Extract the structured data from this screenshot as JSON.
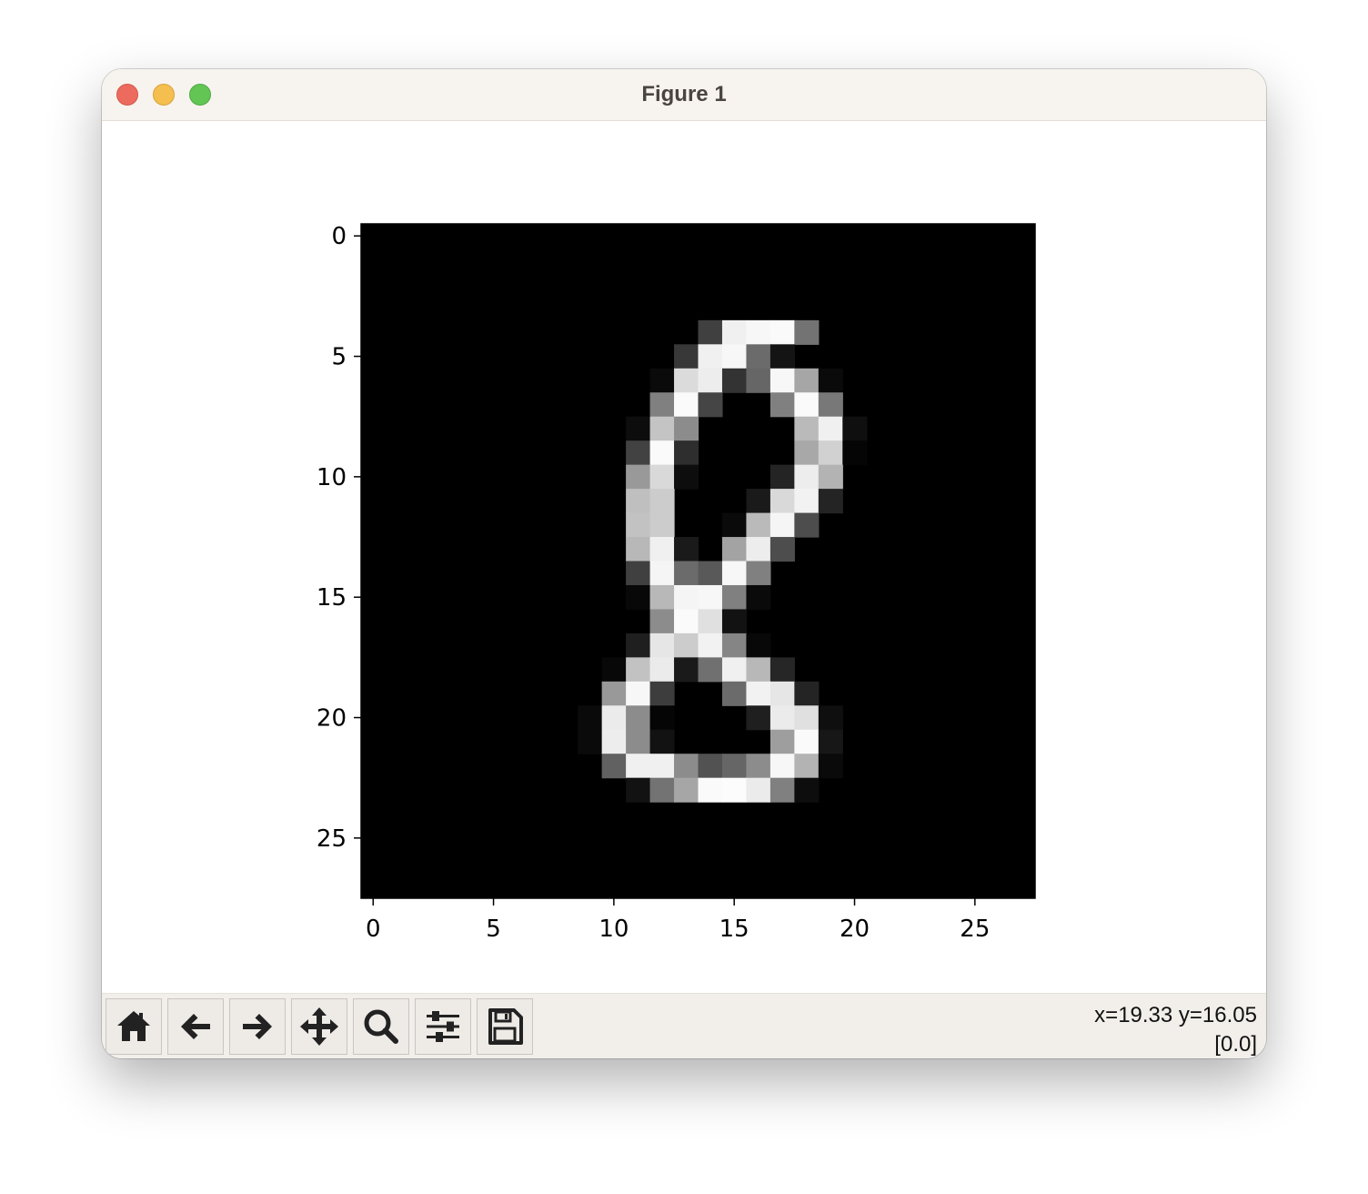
{
  "window": {
    "title": "Figure 1",
    "traffic_lights": {
      "close": "#ed6a5e",
      "minimize": "#f5bf4f",
      "zoom": "#62c554"
    }
  },
  "toolbar": {
    "buttons": [
      {
        "name": "home",
        "icon": "home-icon"
      },
      {
        "name": "back",
        "icon": "arrow-left-icon"
      },
      {
        "name": "forward",
        "icon": "arrow-right-icon"
      },
      {
        "name": "pan",
        "icon": "move-arrows-icon"
      },
      {
        "name": "zoom",
        "icon": "magnifier-icon"
      },
      {
        "name": "configure-subplots",
        "icon": "sliders-icon"
      },
      {
        "name": "save",
        "icon": "floppy-disk-icon"
      }
    ],
    "status_coords": "x=19.33 y=16.05",
    "status_value": "[0.0]"
  },
  "chart_data": {
    "type": "heatmap",
    "colormap": "gray",
    "shape": [
      28,
      28
    ],
    "xlim": [
      -0.5,
      27.5
    ],
    "ylim": [
      27.5,
      -0.5
    ],
    "xticks": [
      0,
      5,
      10,
      15,
      20,
      25
    ],
    "yticks": [
      0,
      5,
      10,
      15,
      20,
      25
    ],
    "pixels": [
      [
        4,
        14,
        0.25
      ],
      [
        4,
        15,
        0.94
      ],
      [
        4,
        16,
        0.97
      ],
      [
        4,
        17,
        0.98
      ],
      [
        4,
        18,
        0.45
      ],
      [
        5,
        13,
        0.22
      ],
      [
        5,
        14,
        0.94
      ],
      [
        5,
        15,
        0.97
      ],
      [
        5,
        16,
        0.42
      ],
      [
        5,
        17,
        0.08
      ],
      [
        6,
        12,
        0.04
      ],
      [
        6,
        13,
        0.86
      ],
      [
        6,
        14,
        0.93
      ],
      [
        6,
        15,
        0.2
      ],
      [
        6,
        16,
        0.4
      ],
      [
        6,
        17,
        0.97
      ],
      [
        6,
        18,
        0.65
      ],
      [
        6,
        19,
        0.04
      ],
      [
        7,
        12,
        0.5
      ],
      [
        7,
        13,
        0.98
      ],
      [
        7,
        14,
        0.27
      ],
      [
        7,
        17,
        0.5
      ],
      [
        7,
        18,
        0.98
      ],
      [
        7,
        19,
        0.47
      ],
      [
        8,
        11,
        0.05
      ],
      [
        8,
        12,
        0.77
      ],
      [
        8,
        13,
        0.55
      ],
      [
        8,
        18,
        0.73
      ],
      [
        8,
        19,
        0.94
      ],
      [
        8,
        20,
        0.06
      ],
      [
        9,
        11,
        0.26
      ],
      [
        9,
        12,
        0.98
      ],
      [
        9,
        13,
        0.18
      ],
      [
        9,
        18,
        0.66
      ],
      [
        9,
        19,
        0.82
      ],
      [
        9,
        20,
        0.02
      ],
      [
        10,
        11,
        0.6
      ],
      [
        10,
        12,
        0.85
      ],
      [
        10,
        13,
        0.05
      ],
      [
        10,
        17,
        0.14
      ],
      [
        10,
        18,
        0.93
      ],
      [
        10,
        19,
        0.7
      ],
      [
        11,
        11,
        0.75
      ],
      [
        11,
        12,
        0.8
      ],
      [
        11,
        16,
        0.1
      ],
      [
        11,
        17,
        0.85
      ],
      [
        11,
        18,
        0.95
      ],
      [
        11,
        19,
        0.14
      ],
      [
        12,
        11,
        0.76
      ],
      [
        12,
        12,
        0.8
      ],
      [
        12,
        15,
        0.04
      ],
      [
        12,
        16,
        0.73
      ],
      [
        12,
        17,
        0.96
      ],
      [
        12,
        18,
        0.3
      ],
      [
        13,
        11,
        0.72
      ],
      [
        13,
        12,
        0.94
      ],
      [
        13,
        13,
        0.1
      ],
      [
        13,
        15,
        0.64
      ],
      [
        13,
        16,
        0.93
      ],
      [
        13,
        17,
        0.3
      ],
      [
        14,
        11,
        0.25
      ],
      [
        14,
        12,
        0.96
      ],
      [
        14,
        13,
        0.42
      ],
      [
        14,
        14,
        0.35
      ],
      [
        14,
        15,
        0.97
      ],
      [
        14,
        16,
        0.5
      ],
      [
        15,
        11,
        0.03
      ],
      [
        15,
        12,
        0.72
      ],
      [
        15,
        13,
        0.96
      ],
      [
        15,
        14,
        0.97
      ],
      [
        15,
        15,
        0.5
      ],
      [
        15,
        16,
        0.04
      ],
      [
        16,
        12,
        0.55
      ],
      [
        16,
        13,
        0.98
      ],
      [
        16,
        14,
        0.88
      ],
      [
        16,
        15,
        0.07
      ],
      [
        17,
        11,
        0.12
      ],
      [
        17,
        12,
        0.9
      ],
      [
        17,
        13,
        0.8
      ],
      [
        17,
        14,
        0.95
      ],
      [
        17,
        15,
        0.52
      ],
      [
        17,
        16,
        0.03
      ],
      [
        18,
        10,
        0.03
      ],
      [
        18,
        11,
        0.76
      ],
      [
        18,
        12,
        0.92
      ],
      [
        18,
        13,
        0.1
      ],
      [
        18,
        14,
        0.44
      ],
      [
        18,
        15,
        0.94
      ],
      [
        18,
        16,
        0.72
      ],
      [
        18,
        17,
        0.15
      ],
      [
        19,
        10,
        0.6
      ],
      [
        19,
        11,
        0.97
      ],
      [
        19,
        12,
        0.24
      ],
      [
        19,
        15,
        0.42
      ],
      [
        19,
        16,
        0.95
      ],
      [
        19,
        17,
        0.9
      ],
      [
        19,
        18,
        0.14
      ],
      [
        20,
        9,
        0.04
      ],
      [
        20,
        10,
        0.92
      ],
      [
        20,
        11,
        0.55
      ],
      [
        20,
        12,
        0.02
      ],
      [
        20,
        16,
        0.12
      ],
      [
        20,
        17,
        0.92
      ],
      [
        20,
        18,
        0.88
      ],
      [
        20,
        19,
        0.06
      ],
      [
        21,
        9,
        0.04
      ],
      [
        21,
        10,
        0.93
      ],
      [
        21,
        11,
        0.55
      ],
      [
        21,
        12,
        0.07
      ],
      [
        21,
        17,
        0.62
      ],
      [
        21,
        18,
        0.98
      ],
      [
        21,
        19,
        0.09
      ],
      [
        22,
        10,
        0.38
      ],
      [
        22,
        11,
        0.94
      ],
      [
        22,
        12,
        0.94
      ],
      [
        22,
        13,
        0.55
      ],
      [
        22,
        14,
        0.32
      ],
      [
        22,
        15,
        0.4
      ],
      [
        22,
        16,
        0.55
      ],
      [
        22,
        17,
        0.97
      ],
      [
        22,
        18,
        0.7
      ],
      [
        22,
        19,
        0.04
      ],
      [
        23,
        11,
        0.07
      ],
      [
        23,
        12,
        0.45
      ],
      [
        23,
        13,
        0.65
      ],
      [
        23,
        14,
        0.98
      ],
      [
        23,
        15,
        0.99
      ],
      [
        23,
        16,
        0.92
      ],
      [
        23,
        17,
        0.5
      ],
      [
        23,
        18,
        0.05
      ]
    ]
  }
}
